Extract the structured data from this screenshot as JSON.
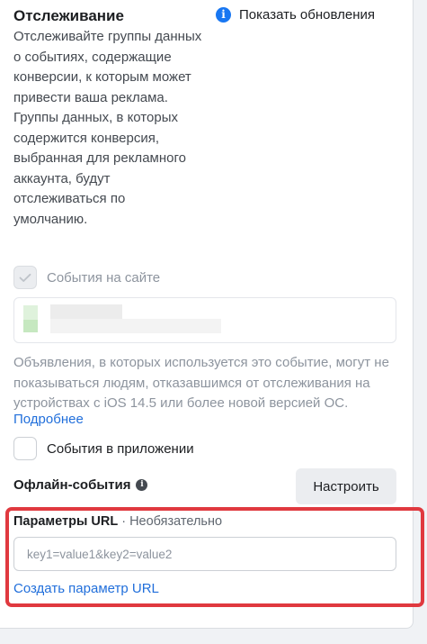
{
  "tracking": {
    "title": "Отслеживание",
    "description": "Отслеживайте группы данных о событиях, содержащие конверсии, к которым может привести ваша реклама. Группы данных, в которых содержится конверсия, выбранная для рекламного аккаунта, будут отслеживаться по умолчанию.",
    "show_updates_label": "Показать обновления",
    "show_updates_icon": "info-icon"
  },
  "website_events": {
    "label": "События на сайте",
    "checked": true,
    "disabled": true,
    "note": "Объявления, в которых используется это событие, могут не показываться людям, отказавшимся от отслеживания на устройствах с iOS 14.5 или более новой версией ОС.",
    "more_link": "Подробнее"
  },
  "app_events": {
    "label": "События в приложении",
    "checked": false
  },
  "offline_events": {
    "label": "Офлайн-события",
    "icon": "info-icon",
    "setup_button": "Настроить"
  },
  "url_params": {
    "label": "Параметры URL",
    "optional": "· Необязательно",
    "placeholder": "key1=value1&key2=value2",
    "value": "",
    "create_link": "Создать параметр URL"
  },
  "colors": {
    "accent": "#1877f2",
    "link": "#216fdb",
    "highlight_border": "#e0393f",
    "muted_text": "#8d949e"
  }
}
